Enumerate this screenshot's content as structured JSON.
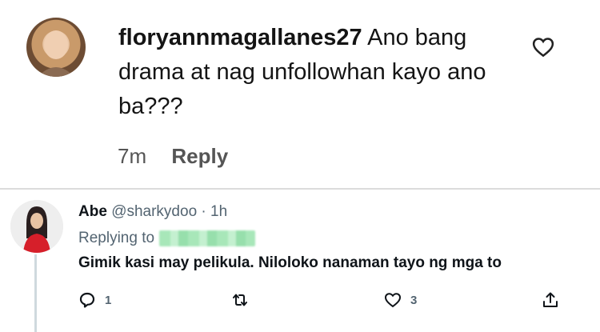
{
  "comment": {
    "username": "floryannmagallanes27",
    "text": "Ano bang drama at nag unfollowhan kayo ano ba???",
    "time": "7m",
    "reply_label": "Reply",
    "icons": {
      "like": "heart-outline-icon",
      "avatar": "avatar-photo"
    }
  },
  "tweet": {
    "display_name": "Abe",
    "handle": "@sharkydoo",
    "separator": "·",
    "time": "1h",
    "replying_to_label": "Replying to",
    "text": "Gimik kasi may pelikula. Nilolokо nanaman tayo ng mga to",
    "reply_count": "1",
    "like_count": "3",
    "icons": {
      "reply": "reply-bubble-icon",
      "retweet": "retweet-icon",
      "like": "heart-outline-icon",
      "share": "share-icon"
    },
    "colors": {
      "muted": "#536471",
      "thread": "#cfd9de"
    }
  }
}
